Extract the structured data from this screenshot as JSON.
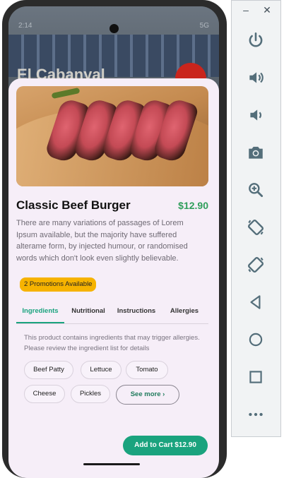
{
  "background_app": {
    "title": "El Cabanyal",
    "status_time": "2:14",
    "status_right": "5G"
  },
  "product": {
    "name": "Classic Beef Burger",
    "price": "$12.90",
    "description": "There are many variations of passages of Lorem Ipsum available, but the majority have suffered alterame form, by injected humour, or randomised words which don't look even slightly believable.",
    "promotions_label": "2 Promotions Available"
  },
  "tabs": [
    {
      "label": "Ingredients",
      "active": true
    },
    {
      "label": "Nutritional",
      "active": false
    },
    {
      "label": "Instructions",
      "active": false
    },
    {
      "label": "Allergies",
      "active": false
    }
  ],
  "ingredients": {
    "note": "This product contains ingredients that may trigger allergies. Please review the ingredient list for details",
    "items": [
      "Beef Patty",
      "Lettuce",
      "Tomato",
      "Cheese",
      "Pickles"
    ],
    "see_more_label": "See more ›"
  },
  "actions": {
    "add_to_cart_label": "Add to Cart $12.90"
  },
  "emulator": {
    "minimize": "–",
    "close": "✕",
    "tools": [
      "power-icon",
      "volume-up-icon",
      "volume-down-icon",
      "camera-icon",
      "zoom-icon",
      "rotate-left-icon",
      "rotate-right-icon",
      "back-icon",
      "home-icon",
      "overview-icon",
      "more-icon"
    ],
    "accent_color": "#546e7a"
  },
  "colors": {
    "accent_green": "#1aa37e",
    "price_green": "#2f9e5b",
    "promo_yellow": "#f6b300",
    "sheet_bg": "#f6eef8"
  }
}
